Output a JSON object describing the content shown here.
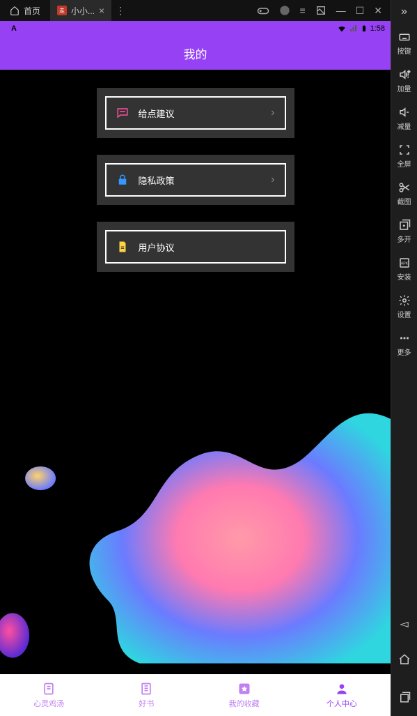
{
  "emubar": {
    "home": "首页",
    "app_tab": "小小..."
  },
  "status": {
    "badge": "A",
    "time": "1:58"
  },
  "header": {
    "title": "我的"
  },
  "menu": [
    {
      "label": "给点建议",
      "chevron": true
    },
    {
      "label": "隐私政策",
      "chevron": true
    },
    {
      "label": "用户协议",
      "chevron": false
    }
  ],
  "bottomnav": {
    "items": [
      {
        "label": "心灵鸡汤"
      },
      {
        "label": "好书"
      },
      {
        "label": "我的收藏"
      },
      {
        "label": "个人中心"
      }
    ]
  },
  "sidebar": {
    "items": [
      {
        "label": "按键"
      },
      {
        "label": "加量"
      },
      {
        "label": "减量"
      },
      {
        "label": "全屏"
      },
      {
        "label": "截图"
      },
      {
        "label": "多开"
      },
      {
        "label": "安装"
      },
      {
        "label": "设置"
      },
      {
        "label": "更多"
      }
    ]
  }
}
